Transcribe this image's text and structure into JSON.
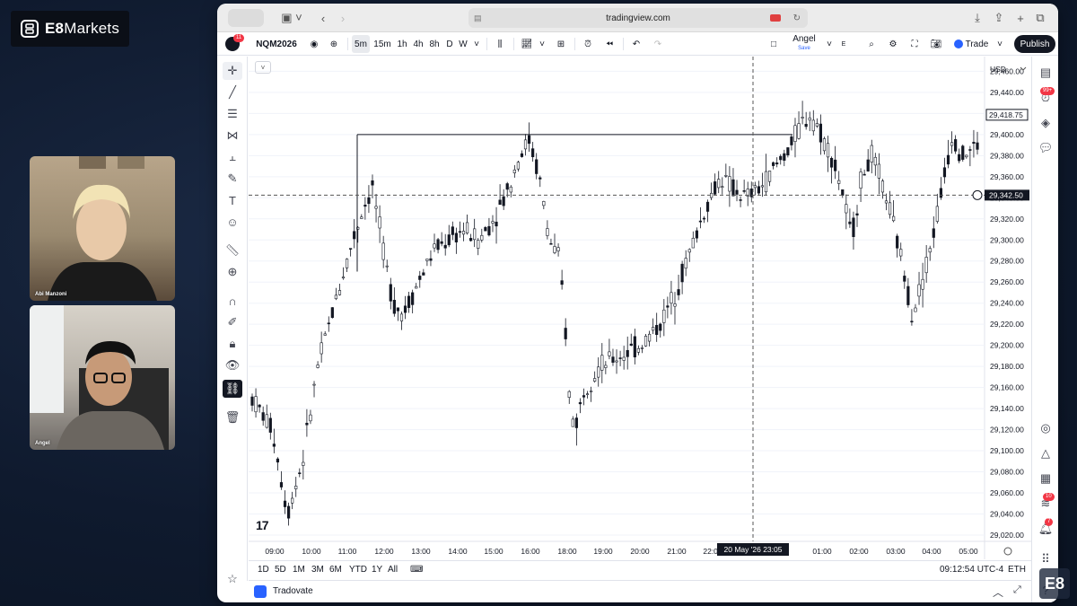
{
  "brand": {
    "name_bold": "E8",
    "name_rest": "Markets"
  },
  "participants": [
    {
      "name": "Abi Manzoni"
    },
    {
      "name": "Angel"
    }
  ],
  "browser": {
    "url": "tradingview.com"
  },
  "toolbar": {
    "avatar_badge": "11",
    "symbol": "NQM2026",
    "intervals": [
      "5m",
      "15m",
      "1h",
      "4h",
      "8h",
      "D",
      "W"
    ],
    "active_interval": "5m",
    "layout_name": "Angel",
    "layout_status": "Save",
    "layout_key": "E",
    "trade_label": "Trade",
    "publish_label": "Publish"
  },
  "right_bar": {
    "alerts_badge": "99+",
    "streams_badge": "10",
    "notifications_badge": "7"
  },
  "chart": {
    "currency": "USD",
    "last_price_label": "29,418.75",
    "crosshair_price_label": "29,342.50",
    "crosshair_time_label": "20 May '26  23:05",
    "colors": {
      "candle": "#131722",
      "grid": "#f0f3fa",
      "price_tag_dark": "#131722",
      "line": "#131722"
    }
  },
  "chart_data": {
    "type": "candlestick",
    "y_ticks": [
      "29,460.00",
      "29,440.00",
      "29,420.00",
      "29,400.00",
      "29,380.00",
      "29,360.00",
      "29,340.00",
      "29,320.00",
      "29,300.00",
      "29,280.00",
      "29,260.00",
      "29,240.00",
      "29,220.00",
      "29,200.00",
      "29,180.00",
      "29,160.00",
      "29,140.00",
      "29,120.00",
      "29,100.00",
      "29,080.00",
      "29,060.00",
      "29,040.00",
      "29,020.00"
    ],
    "x_ticks": [
      "09:00",
      "10:00",
      "11:00",
      "12:00",
      "13:00",
      "14:00",
      "15:00",
      "16:00",
      "18:00",
      "19:00",
      "20:00",
      "21:00",
      "22:00",
      "01:00",
      "02:00",
      "03:00",
      "04:00",
      "05:00"
    ],
    "ylim": [
      29014,
      29474
    ],
    "horizontal_line_level": 29400,
    "path_points": [
      [
        0,
        29150
      ],
      [
        8,
        29120
      ],
      [
        14,
        29040
      ],
      [
        20,
        29090
      ],
      [
        26,
        29180
      ],
      [
        34,
        29250
      ],
      [
        40,
        29300
      ],
      [
        44,
        29330
      ],
      [
        48,
        29350
      ],
      [
        52,
        29290
      ],
      [
        56,
        29240
      ],
      [
        60,
        29230
      ],
      [
        66,
        29260
      ],
      [
        72,
        29290
      ],
      [
        78,
        29300
      ],
      [
        84,
        29310
      ],
      [
        90,
        29300
      ],
      [
        96,
        29320
      ],
      [
        102,
        29350
      ],
      [
        106,
        29380
      ],
      [
        110,
        29395
      ],
      [
        114,
        29360
      ],
      [
        118,
        29300
      ],
      [
        122,
        29280
      ],
      [
        124,
        29230
      ],
      [
        126,
        29150
      ],
      [
        128,
        29120
      ],
      [
        132,
        29160
      ],
      [
        138,
        29180
      ],
      [
        146,
        29190
      ],
      [
        154,
        29200
      ],
      [
        162,
        29220
      ],
      [
        168,
        29250
      ],
      [
        174,
        29290
      ],
      [
        180,
        29330
      ],
      [
        186,
        29360
      ],
      [
        190,
        29350
      ],
      [
        196,
        29340
      ],
      [
        202,
        29350
      ],
      [
        208,
        29370
      ],
      [
        214,
        29390
      ],
      [
        218,
        29410
      ],
      [
        222,
        29420
      ],
      [
        226,
        29400
      ],
      [
        230,
        29380
      ],
      [
        234,
        29350
      ],
      [
        238,
        29300
      ],
      [
        242,
        29360
      ],
      [
        246,
        29380
      ],
      [
        252,
        29340
      ],
      [
        258,
        29280
      ],
      [
        262,
        29230
      ],
      [
        266,
        29260
      ],
      [
        270,
        29300
      ],
      [
        274,
        29350
      ],
      [
        278,
        29400
      ],
      [
        282,
        29380
      ],
      [
        288,
        29390
      ]
    ]
  },
  "bottom_bar": {
    "ranges": [
      "1D",
      "5D",
      "1M",
      "3M",
      "6M",
      "YTD",
      "1Y",
      "All"
    ],
    "clock": "09:12:54 UTC-4",
    "session": "ETH"
  },
  "trading_panel": {
    "broker": "Tradovate"
  },
  "corner_logo": "E8"
}
